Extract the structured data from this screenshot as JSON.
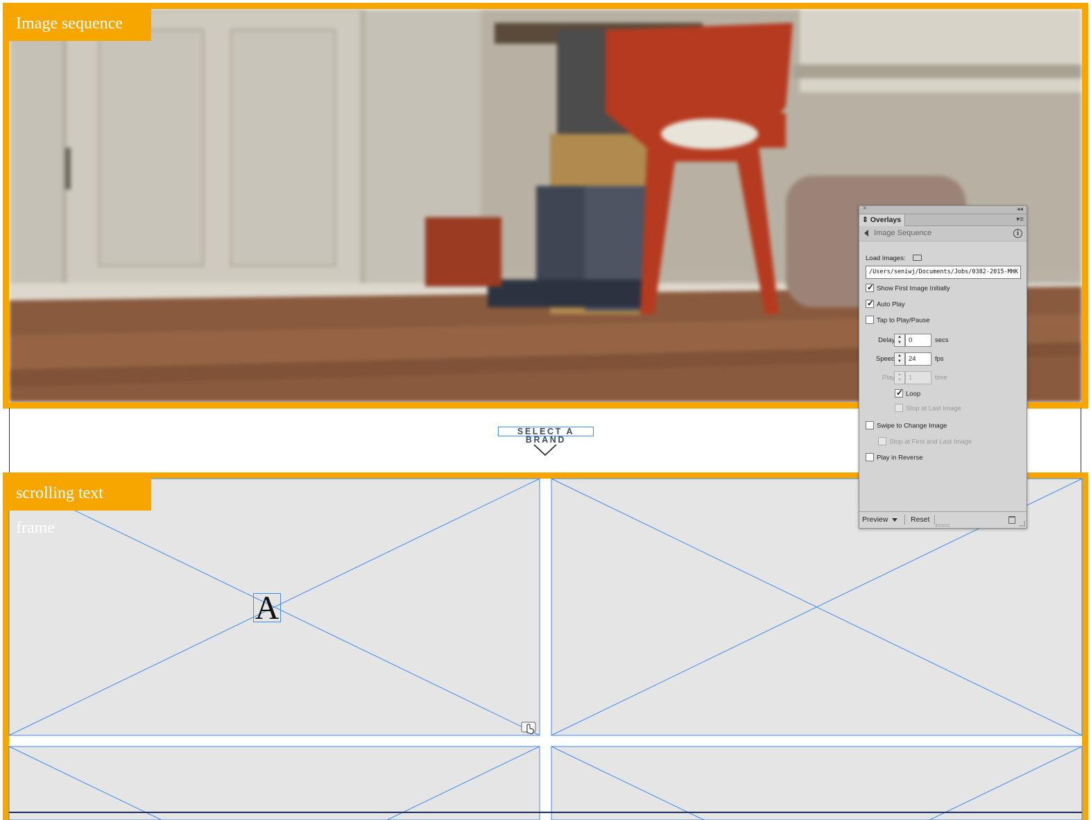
{
  "frames": {
    "image_sequence_label": "Image sequence",
    "scrolling_text_label": "scrolling text frame"
  },
  "middle": {
    "select_brand": "SELECT A BRAND"
  },
  "scroll_frame": {
    "glyph": "A"
  },
  "overlays_panel": {
    "tab_title": "Overlays",
    "subtitle": "Image Sequence",
    "load_images_label": "Load Images:",
    "path_value": "/Users/seniwj/Documents/Jobs/0382-2015-MHK",
    "show_first_image": {
      "label": "Show First Image Initially",
      "checked": true
    },
    "auto_play": {
      "label": "Auto Play",
      "checked": true
    },
    "tap_to_play": {
      "label": "Tap to Play/Pause",
      "checked": false
    },
    "delay": {
      "label": "Delay:",
      "value": "0",
      "unit": "secs"
    },
    "speed": {
      "label": "Speed:",
      "value": "24",
      "unit": "fps"
    },
    "play": {
      "label": "Play:",
      "value": "1",
      "unit": "time",
      "disabled": true
    },
    "loop": {
      "label": "Loop",
      "checked": true
    },
    "stop_at_last": {
      "label": "Stop at Last Image",
      "checked": false,
      "disabled": true
    },
    "swipe_to_change": {
      "label": "Swipe to Change Image",
      "checked": false
    },
    "stop_first_last": {
      "label": "Stop at First and Last Image",
      "checked": false,
      "disabled": true
    },
    "play_in_reverse": {
      "label": "Play in Reverse",
      "checked": false
    },
    "footer": {
      "preview": "Preview",
      "reset": "Reset"
    }
  },
  "colors": {
    "frame_accent": "#f7a600",
    "guide_blue": "#3d8cf0",
    "placeholder_gray": "#e5e5e5"
  }
}
